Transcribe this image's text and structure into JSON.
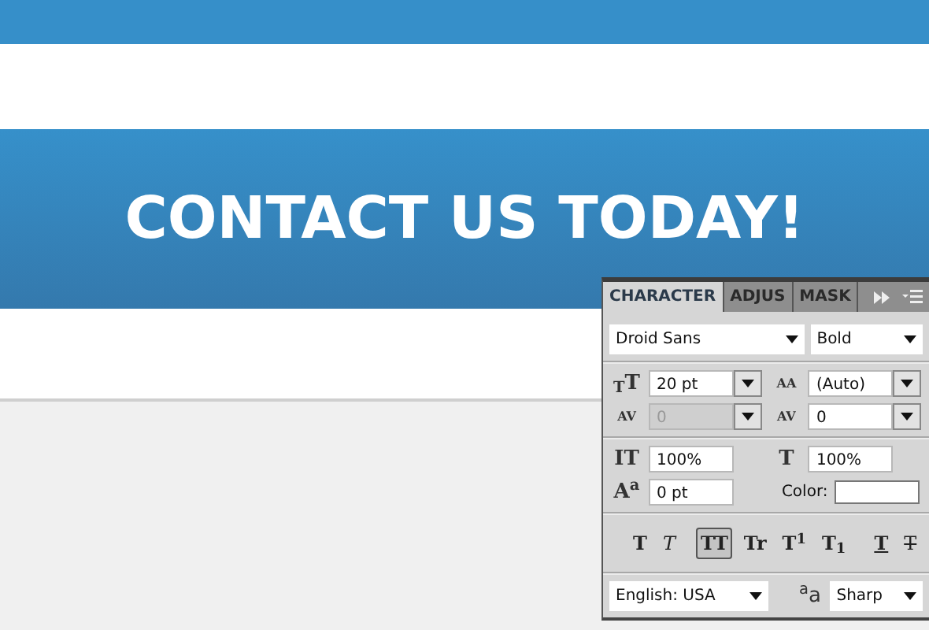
{
  "canvas": {
    "heading": "CONTACT US TODAY!"
  },
  "panel": {
    "tabs": [
      {
        "label": "CHARACTER",
        "selected": true
      },
      {
        "label": "ADJUS",
        "selected": false
      },
      {
        "label": "MASK",
        "selected": false
      }
    ],
    "font_family": "Droid Sans",
    "font_style": "Bold",
    "groups": [
      [
        [
          {
            "glyph": "$_{T}$T",
            "kind": "combo",
            "value": "20 pt",
            "disabled": false
          },
          {
            "glyph": "AA",
            "kind": "combo",
            "value": "(Auto)",
            "disabled": false
          }
        ],
        [
          {
            "glyph": "AV",
            "kind": "combo",
            "value": "0",
            "disabled": true
          },
          {
            "glyph": "AV",
            "kind": "combo",
            "value": "0",
            "disabled": false
          }
        ]
      ],
      [
        [
          {
            "glyph": "IT",
            "kind": "field",
            "value": "100%",
            "disabled": false
          },
          {
            "glyph": "T",
            "kind": "field",
            "value": "100%",
            "disabled": false
          }
        ],
        [
          {
            "glyph": "A$^{a}$",
            "kind": "field",
            "value": "0 pt",
            "disabled": false
          },
          {
            "label": "Color:",
            "kind": "color",
            "color": "#ffffff"
          }
        ]
      ]
    ],
    "style_buttons": [
      {
        "label": "T",
        "kind": "bold",
        "selected": false
      },
      {
        "label": "T",
        "kind": "italic",
        "selected": false
      },
      {
        "label": "TT",
        "kind": "caps",
        "selected": true
      },
      {
        "label": "Tr",
        "kind": "smallcaps",
        "selected": false
      },
      {
        "label": "T$^{1}$",
        "kind": "super",
        "selected": false
      },
      {
        "label": "T$_{1}$",
        "kind": "sub",
        "selected": false
      },
      {
        "label": "T",
        "kind": "underline",
        "selected": false
      },
      {
        "label": "T",
        "kind": "strike",
        "selected": false
      }
    ],
    "language": "English: USA",
    "antialias_glyph": "$^{a}$a",
    "antialias": "Sharp"
  }
}
